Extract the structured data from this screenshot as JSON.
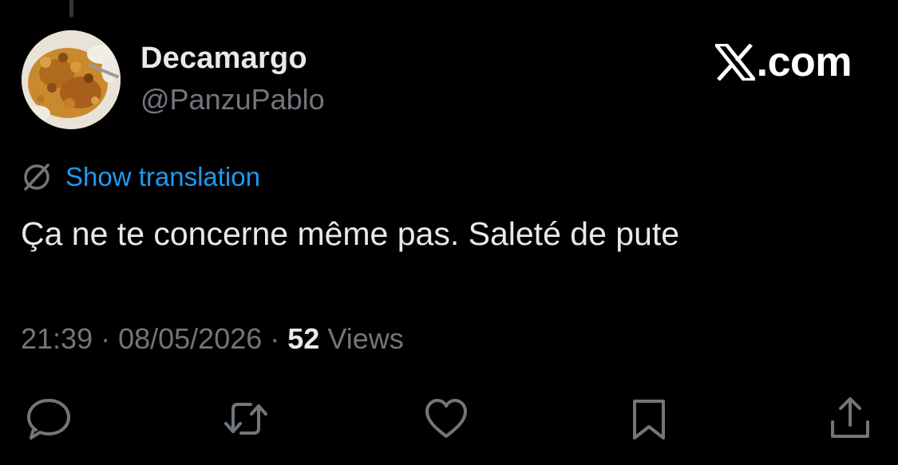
{
  "tweet": {
    "author": {
      "display_name": "Decamargo",
      "handle": "@PanzuPablo"
    },
    "brand": {
      "text": ".com",
      "icon": "x-logo-icon"
    },
    "translation": {
      "icon": "globe-slash-icon",
      "label": "Show translation"
    },
    "text": "Ça ne te concerne même pas. Saleté de pute",
    "meta": {
      "time": "21:39",
      "separator": " · ",
      "date": "08/05/2026",
      "views_count": "52",
      "views_label": " Views"
    },
    "actions": [
      {
        "name": "reply",
        "icon": "reply-icon"
      },
      {
        "name": "repost",
        "icon": "repost-icon"
      },
      {
        "name": "like",
        "icon": "heart-icon"
      },
      {
        "name": "bookmark",
        "icon": "bookmark-icon"
      },
      {
        "name": "share",
        "icon": "share-icon"
      }
    ]
  },
  "colors": {
    "background": "#000000",
    "text_primary": "#e7e9ea",
    "text_secondary": "#71767b",
    "link": "#1d9bf0"
  }
}
